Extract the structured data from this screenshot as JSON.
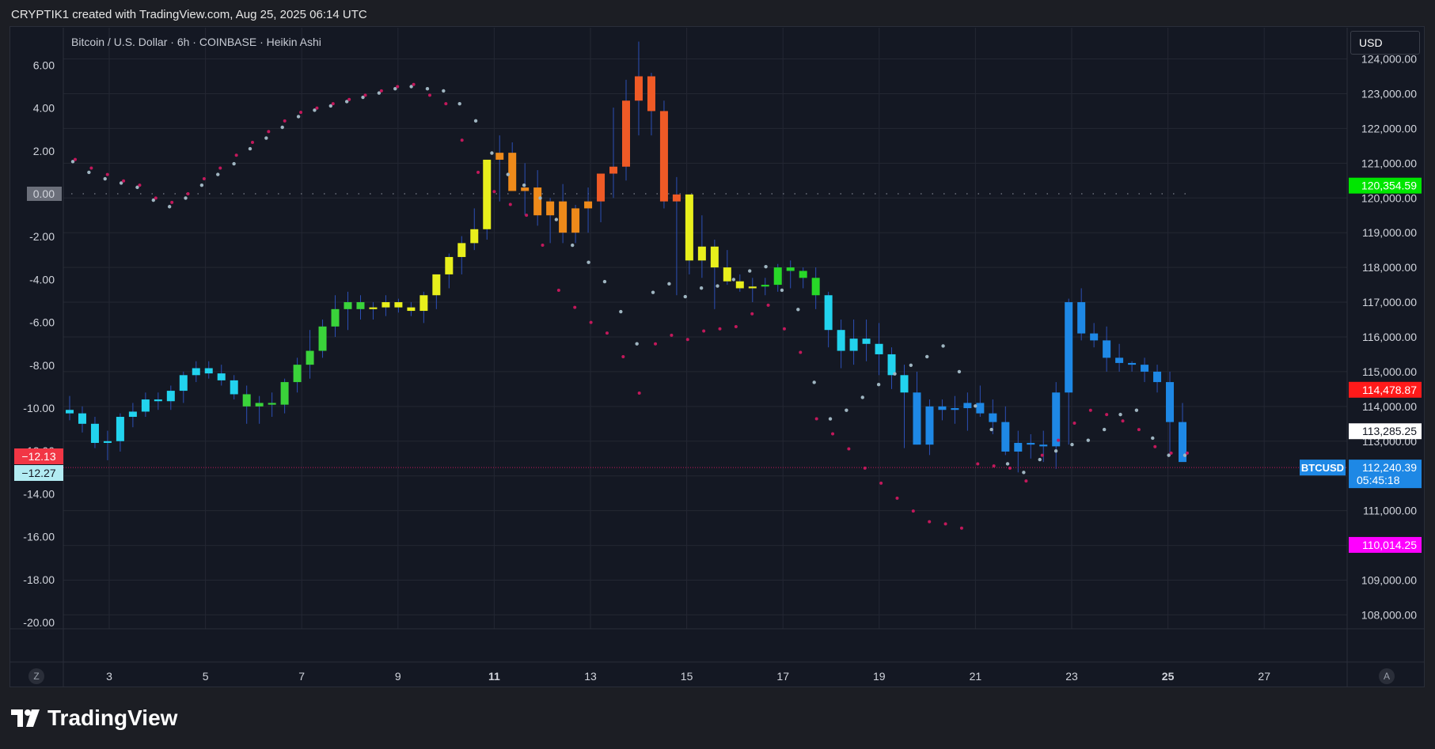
{
  "header": {
    "text": "CRYPTIK1 created with TradingView.com, Aug 25, 2025 06:14 UTC"
  },
  "footer": {
    "brand": "TradingView"
  },
  "controls": {
    "currency": "USD",
    "left_corner": "Z",
    "right_corner": "A"
  },
  "colors": {
    "bg": "#141823",
    "grid": "#232733",
    "up": "#7cfc00",
    "down": "#ff3b3b"
  },
  "chart_data": {
    "type": "candlestick",
    "title": "Bitcoin / U.S. Dollar · 6h · COINBASE · Heikin Ashi",
    "symbol": "BTCUSD",
    "x_ticks": [
      "3",
      "5",
      "7",
      "9",
      "11",
      "13",
      "15",
      "17",
      "19",
      "21",
      "23",
      "25",
      "27"
    ],
    "price_axis": {
      "ylim": [
        107500,
        125000
      ],
      "ticks": [
        "124,000.00",
        "123,000.00",
        "122,000.00",
        "121,000.00",
        "120,000.00",
        "119,000.00",
        "118,000.00",
        "117,000.00",
        "116,000.00",
        "115,000.00",
        "114,000.00",
        "113,000.00",
        "112,000.00",
        "111,000.00",
        "110,000.00",
        "109,000.00",
        "108,000.00"
      ]
    },
    "oscillator_axis": {
      "ticks": [
        "6.00",
        "4.00",
        "2.00",
        "0.00",
        "-2.00",
        "-4.00",
        "-6.00",
        "-8.00",
        "-10.00",
        "-12.00",
        "-14.00",
        "-16.00",
        "-18.00",
        "-20.00"
      ]
    },
    "price_labels": [
      {
        "text": "120,354.59",
        "value": 120354.59,
        "color": "#00e600"
      },
      {
        "text": "114,478.87",
        "value": 114478.87,
        "color": "#ff1a1a"
      },
      {
        "text": "113,285.25",
        "value": 113285.25,
        "color": "#ffffff"
      },
      {
        "text": "112,240.39",
        "value": 112240.39,
        "color": "#1e88e5",
        "sub": "05:45:18",
        "tag": "BTCUSD"
      },
      {
        "text": "110,014.25",
        "value": 110014.25,
        "color": "#ff00ff"
      }
    ],
    "osc_labels": [
      {
        "text": "−12.13",
        "value": -12.13,
        "color": "#f23645"
      },
      {
        "text": "−12.27",
        "value": -12.27,
        "color": "#b2ebf2"
      }
    ],
    "candles": [
      [
        113900,
        114300,
        113600,
        113800
      ],
      [
        113800,
        114000,
        113250,
        113500
      ],
      [
        113500,
        113700,
        112800,
        112950
      ],
      [
        112950,
        113300,
        112450,
        113000
      ],
      [
        113000,
        113800,
        112700,
        113700
      ],
      [
        113700,
        114100,
        113400,
        113850
      ],
      [
        113850,
        114400,
        113700,
        114200
      ],
      [
        114200,
        114400,
        113900,
        114150
      ],
      [
        114150,
        114600,
        113900,
        114450
      ],
      [
        114450,
        115000,
        114100,
        114900
      ],
      [
        114900,
        115300,
        114700,
        115100
      ],
      [
        115100,
        115300,
        114800,
        114950
      ],
      [
        114950,
        115200,
        114600,
        114750
      ],
      [
        114750,
        114900,
        114200,
        114350
      ],
      [
        114350,
        114600,
        113500,
        114000
      ],
      [
        114000,
        114300,
        113500,
        114100
      ],
      [
        114100,
        114400,
        113700,
        114050
      ],
      [
        114050,
        114800,
        113800,
        114700
      ],
      [
        114700,
        115400,
        114400,
        115200
      ],
      [
        115200,
        116200,
        114800,
        115600
      ],
      [
        115600,
        116500,
        115400,
        116300
      ],
      [
        116300,
        117200,
        116000,
        116800
      ],
      [
        116800,
        117300,
        116200,
        117000
      ],
      [
        117000,
        117200,
        116500,
        116800
      ],
      [
        116800,
        117000,
        116500,
        116850
      ],
      [
        116850,
        117200,
        116600,
        117000
      ],
      [
        117000,
        117100,
        116700,
        116850
      ],
      [
        116850,
        117000,
        116600,
        116750
      ],
      [
        116750,
        117300,
        116400,
        117200
      ],
      [
        117200,
        117800,
        116800,
        117800
      ],
      [
        117800,
        118400,
        117400,
        118300
      ],
      [
        118300,
        118900,
        117800,
        118700
      ],
      [
        118700,
        119700,
        118500,
        119100
      ],
      [
        119100,
        121000,
        118800,
        121100
      ],
      [
        121100,
        121800,
        119900,
        121300
      ],
      [
        121300,
        121600,
        120400,
        120200
      ],
      [
        120200,
        121000,
        119500,
        120300
      ],
      [
        120300,
        120800,
        119200,
        119500
      ],
      [
        119500,
        120000,
        118700,
        119900
      ],
      [
        119900,
        120400,
        118700,
        119000
      ],
      [
        119000,
        119800,
        118700,
        119700
      ],
      [
        119700,
        120300,
        119000,
        119900
      ],
      [
        119900,
        120400,
        119300,
        120700
      ],
      [
        120700,
        122600,
        120000,
        120900
      ],
      [
        120900,
        123400,
        120500,
        122800
      ],
      [
        122800,
        124500,
        121800,
        123500
      ],
      [
        123500,
        123600,
        121800,
        122500
      ],
      [
        122500,
        122800,
        119700,
        119900
      ],
      [
        119900,
        120600,
        117200,
        120100
      ],
      [
        120100,
        120000,
        117800,
        118200
      ],
      [
        118200,
        119500,
        117700,
        118600
      ],
      [
        118600,
        118800,
        116800,
        118000
      ],
      [
        118000,
        118500,
        117500,
        117600
      ],
      [
        117600,
        117800,
        117300,
        117400
      ],
      [
        117400,
        117700,
        117000,
        117450
      ],
      [
        117450,
        117700,
        117200,
        117500
      ],
      [
        117500,
        118100,
        117300,
        118000
      ],
      [
        118000,
        118200,
        117400,
        117900
      ],
      [
        117900,
        118000,
        117400,
        117700
      ],
      [
        117700,
        118000,
        116800,
        117200
      ],
      [
        117200,
        117300,
        115700,
        116200
      ],
      [
        116200,
        116500,
        115100,
        115600
      ],
      [
        115600,
        116500,
        115200,
        115950
      ],
      [
        115950,
        116500,
        115300,
        115800
      ],
      [
        115800,
        116400,
        114900,
        115500
      ],
      [
        115500,
        115700,
        114500,
        114900
      ],
      [
        114900,
        115200,
        112800,
        114400
      ],
      [
        114400,
        115000,
        112900,
        112900
      ],
      [
        112900,
        114200,
        112600,
        114000
      ],
      [
        114000,
        114200,
        113600,
        113900
      ],
      [
        113900,
        114300,
        113500,
        113950
      ],
      [
        113950,
        114400,
        113300,
        114100
      ],
      [
        114100,
        114600,
        113700,
        113800
      ],
      [
        113800,
        114200,
        113200,
        113550
      ],
      [
        113550,
        114000,
        112600,
        112700
      ],
      [
        112700,
        113300,
        112100,
        112950
      ],
      [
        112950,
        113200,
        112500,
        112900
      ],
      [
        112900,
        113300,
        112400,
        112850
      ],
      [
        112850,
        114700,
        112200,
        114400
      ],
      [
        114400,
        117100,
        112900,
        117000
      ],
      [
        117000,
        117400,
        115900,
        116100
      ],
      [
        116100,
        116400,
        115700,
        115900
      ],
      [
        115900,
        116300,
        115000,
        115400
      ],
      [
        115400,
        115800,
        115000,
        115250
      ],
      [
        115250,
        115300,
        115000,
        115200
      ],
      [
        115200,
        115400,
        114700,
        115000
      ],
      [
        115000,
        115200,
        114400,
        114700
      ],
      [
        114700,
        115000,
        112600,
        113550
      ],
      [
        113550,
        114100,
        112700,
        112400
      ]
    ],
    "oscillator": {
      "upper": [
        1.5,
        1.0,
        0.7,
        0.5,
        0.3,
        -0.3,
        -0.6,
        -0.2,
        0.4,
        0.9,
        1.4,
        2.1,
        2.6,
        3.1,
        3.6,
        3.9,
        4.1,
        4.3,
        4.5,
        4.7,
        4.9,
        5.0,
        4.9,
        4.8,
        4.2,
        3.4,
        1.9,
        0.9,
        0.4,
        -0.2,
        -1.2,
        -2.4,
        -3.2,
        -4.1,
        -5.5,
        -7.0,
        -4.6,
        -4.2,
        -4.8,
        -4.4,
        -4.3,
        -4.0,
        -3.6,
        -3.4,
        -4.5,
        -5.4,
        -8.8,
        -10.5,
        -10.1,
        -9.5,
        -8.9,
        -8.4,
        -8.0,
        -7.6,
        -7.1,
        -8.3,
        -9.9,
        -11.0,
        -12.6,
        -13.0,
        -12.4,
        -12.0,
        -11.7,
        -11.5,
        -11.0,
        -10.3,
        -10.1,
        -11.4,
        -12.2,
        -12.2
      ],
      "lower": [
        1.6,
        1.2,
        0.9,
        0.6,
        0.4,
        -0.2,
        -0.4,
        0.0,
        0.7,
        1.2,
        1.8,
        2.4,
        2.9,
        3.4,
        3.8,
        4.0,
        4.2,
        4.4,
        4.6,
        4.8,
        5.0,
        5.1,
        4.6,
        4.2,
        2.5,
        1.0,
        0.1,
        -0.5,
        -1.0,
        -2.4,
        -4.5,
        -5.3,
        -6.0,
        -6.5,
        -7.6,
        -9.3,
        -7.0,
        -6.6,
        -6.8,
        -6.4,
        -6.3,
        -6.2,
        -5.6,
        -5.2,
        -6.3,
        -7.4,
        -10.5,
        -11.2,
        -11.9,
        -12.8,
        -13.5,
        -14.2,
        -14.8,
        -15.3,
        -15.4,
        -15.6,
        -12.6,
        -12.7,
        -12.8,
        -13.4,
        -12.2,
        -11.5,
        -10.7,
        -10.1,
        -10.3,
        -10.6,
        -11.0,
        -11.8,
        -12.1,
        -12.1
      ]
    }
  }
}
